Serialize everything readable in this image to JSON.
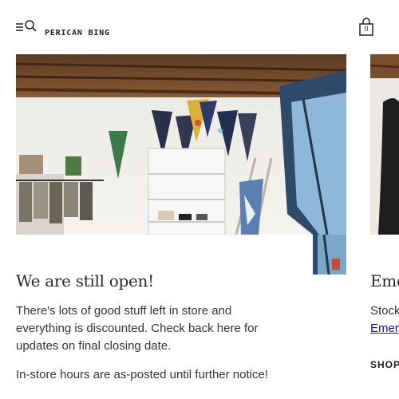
{
  "header": {
    "logo_text": "PERICAN BING",
    "cart_count": "0"
  },
  "cards": [
    {
      "title": "We are still open!",
      "paragraphs": [
        "There's lots of good stuff left in store and everything is discounted. Check back here for updates on final closing date.",
        "In-store hours are as-posted until further notice!"
      ]
    },
    {
      "title": "Eme",
      "paragraphs": [
        "Stock"
      ],
      "link_text": "Emer",
      "shop_label": "SHOP"
    }
  ],
  "icons": {
    "menu": "hamburger-icon",
    "search": "search-icon",
    "cart": "shopping-bag-icon"
  }
}
